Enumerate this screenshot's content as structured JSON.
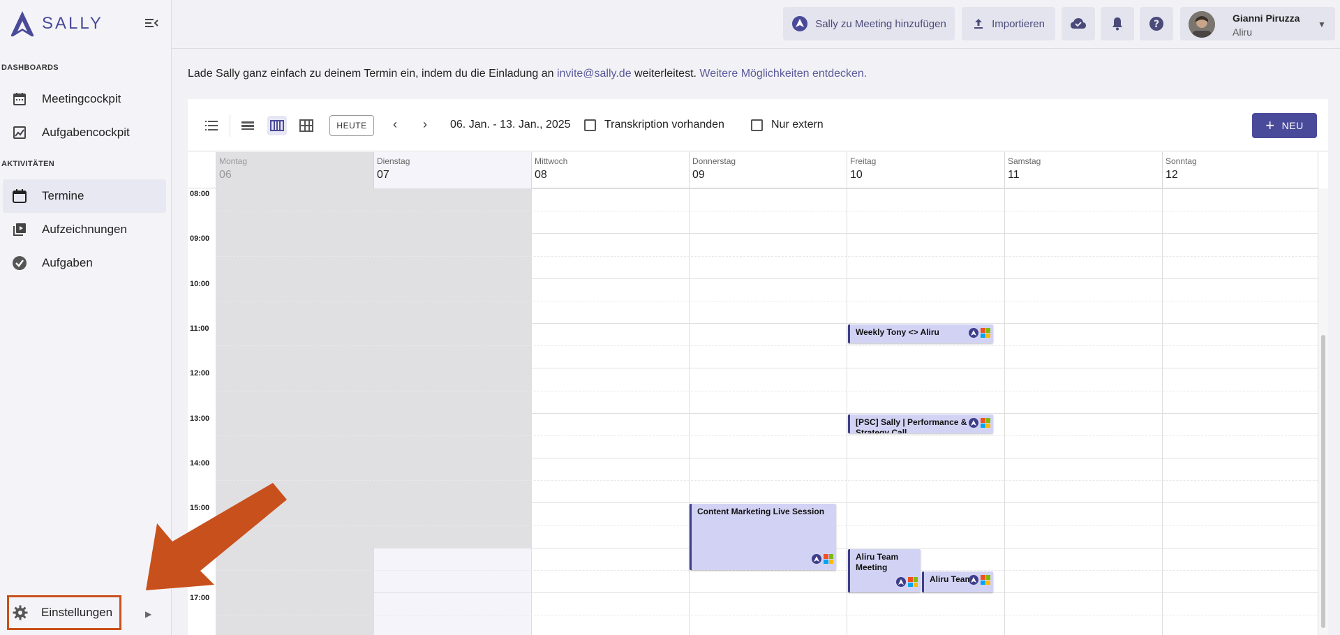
{
  "app": {
    "logo_text": "SALLY"
  },
  "sidebar": {
    "section_dashboards": "DASHBOARDS",
    "section_activities": "AKTIVITÄTEN",
    "items": [
      {
        "label": "Meetingcockpit"
      },
      {
        "label": "Aufgabencockpit"
      },
      {
        "label": "Termine"
      },
      {
        "label": "Aufzeichnungen"
      },
      {
        "label": "Aufgaben"
      }
    ],
    "settings_label": "Einstellungen"
  },
  "topbar": {
    "add_sally_label": "Sally zu Meeting hinzufügen",
    "import_label": "Importieren",
    "user_name": "Gianni Piruzza",
    "user_org": "Aliru"
  },
  "info": {
    "text_before": "Lade Sally ganz einfach zu deinem Termin ein, indem du die Einladung an ",
    "email": "invite@sally.de",
    "text_middle": " weiterleitest. ",
    "more_link": "Weitere Möglichkeiten entdecken."
  },
  "toolbar": {
    "today_label": "HEUTE",
    "date_range": "06. Jan. - 13. Jan., 2025",
    "filter_transcription": "Transkription vorhanden",
    "filter_external": "Nur extern",
    "new_label": "NEU"
  },
  "calendar": {
    "days": [
      {
        "name": "Montag",
        "date": "06"
      },
      {
        "name": "Dienstag",
        "date": "07"
      },
      {
        "name": "Mittwoch",
        "date": "08"
      },
      {
        "name": "Donnerstag",
        "date": "09"
      },
      {
        "name": "Freitag",
        "date": "10"
      },
      {
        "name": "Samstag",
        "date": "11"
      },
      {
        "name": "Sonntag",
        "date": "12"
      }
    ],
    "hours": [
      "08:00",
      "09:00",
      "10:00",
      "11:00",
      "12:00",
      "13:00",
      "14:00",
      "15:00",
      "17:00"
    ],
    "events": [
      {
        "title": "Weekly Tony <> Aliru"
      },
      {
        "title": "[PSC] Sally | Performance & Strategy Call"
      },
      {
        "title": "Content Marketing Live Session"
      },
      {
        "title": "Aliru Team Meeting"
      },
      {
        "title": "Aliru Team"
      }
    ]
  },
  "colors": {
    "brand": "#4a4a9a",
    "event_bg": "#d2d3f4",
    "event_border": "#3e3e8a",
    "highlight": "#c8501c"
  }
}
